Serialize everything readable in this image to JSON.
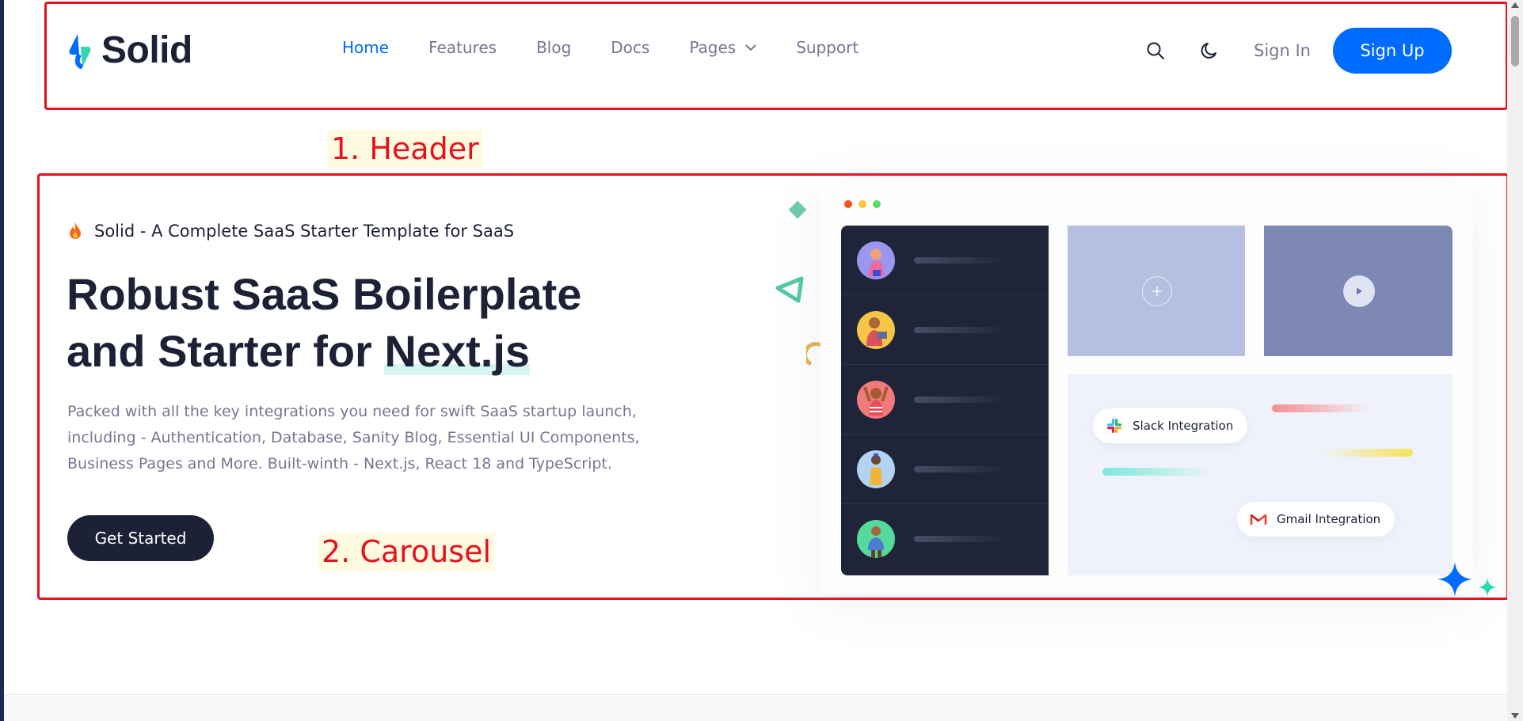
{
  "header": {
    "logo_text": "Solid",
    "nav": [
      {
        "label": "Home",
        "active": true
      },
      {
        "label": "Features",
        "active": false
      },
      {
        "label": "Blog",
        "active": false
      },
      {
        "label": "Docs",
        "active": false
      },
      {
        "label": "Pages",
        "active": false,
        "dropdown": true
      },
      {
        "label": "Support",
        "active": false
      }
    ],
    "search_icon": "search-icon",
    "theme_icon": "moon-icon",
    "sign_in": "Sign In",
    "sign_up": "Sign Up"
  },
  "hero": {
    "tagline": "Solid - A Complete SaaS Starter Template for SaaS",
    "title_line1": "Robust SaaS Boilerplate",
    "title_line2_prefix": "and Starter for ",
    "title_highlight": "Next.js",
    "description": "Packed with all the key integrations you need for swift SaaS startup launch, including - Authentication, Database, Sanity Blog, Essential UI Components, Business Pages and More. Built-winth - Next.js, React 18 and TypeScript.",
    "cta": "Get Started"
  },
  "illustration": {
    "slack_label": "Slack Integration",
    "gmail_label": "Gmail Integration"
  },
  "annotations": {
    "header_label": "1. Header",
    "carousel_label": "2. Carousel"
  },
  "colors": {
    "primary": "#006bff",
    "dark": "#1c2136",
    "muted": "#757693",
    "annotation": "#e8101c"
  }
}
